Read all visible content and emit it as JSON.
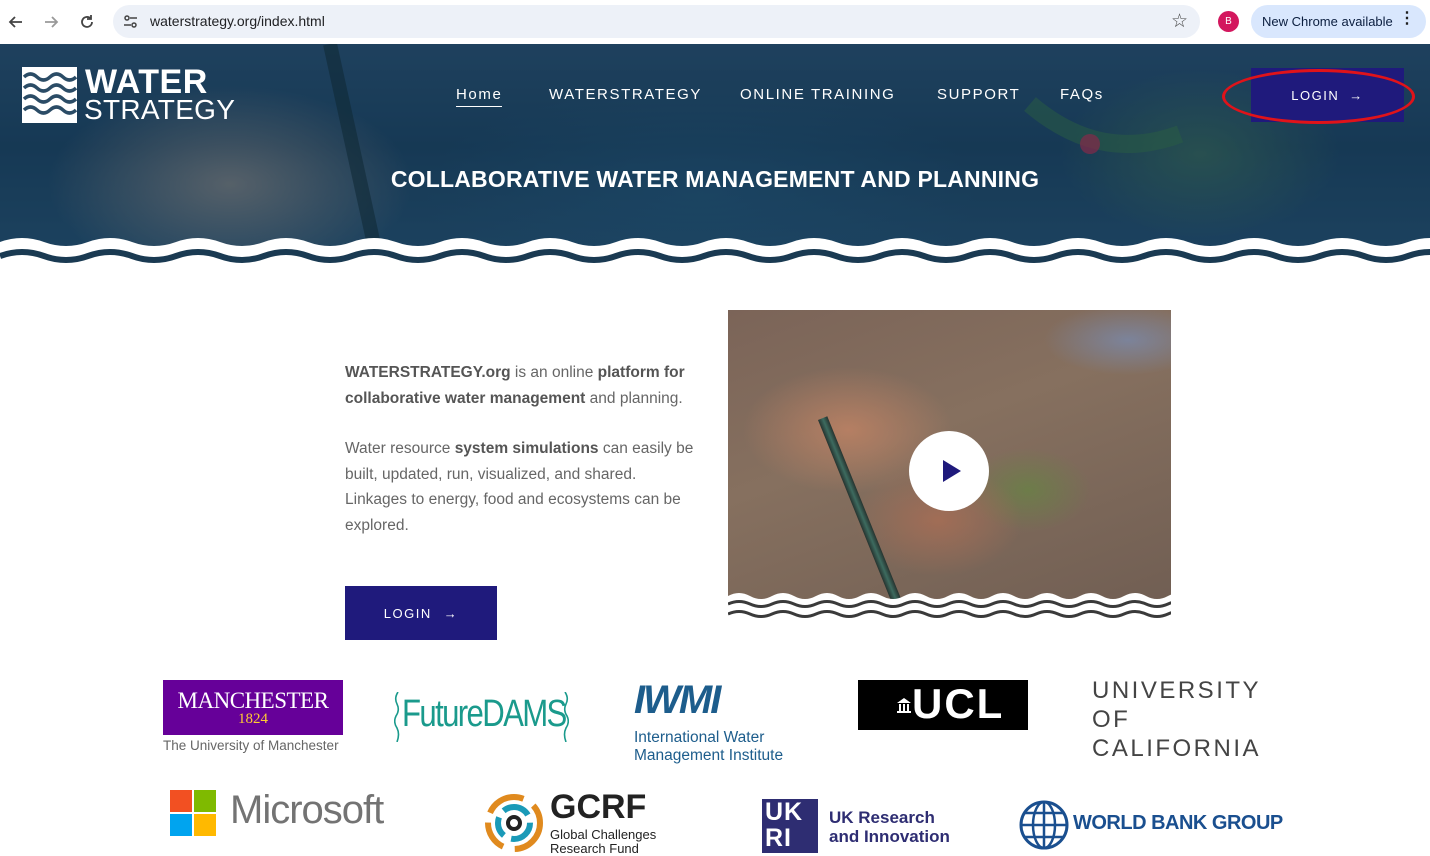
{
  "browser": {
    "url": "waterstrategy.org/index.html",
    "profile_initial": "B",
    "update_label": "New Chrome available"
  },
  "site": {
    "logo": {
      "line1": "WATER",
      "line2": "STRATEGY"
    },
    "nav": [
      {
        "label": "Home",
        "active": true
      },
      {
        "label": "WATERSTRATEGY"
      },
      {
        "label": "ONLINE TRAINING"
      },
      {
        "label": "SUPPORT"
      },
      {
        "label": "FAQs"
      }
    ],
    "header_login": "LOGIN",
    "hero_title": "COLLABORATIVE WATER MANAGEMENT AND PLANNING",
    "intro": {
      "p1": {
        "a": "WATERSTRATEGY.org",
        "b": " is an online ",
        "c": "platform for collaborative water management",
        "d": " and planning."
      },
      "p2": {
        "a": "Water resource ",
        "b": "system simulations",
        "c": " can easily be built, updated, run, visualized, and shared. Linkages to energy, food and ecosystems can be explored."
      }
    },
    "body_login": "LOGIN",
    "arrow": "→"
  },
  "partners": {
    "manchester": {
      "name": "MANCHESTER",
      "year": "1824",
      "sub": "The University of Manchester"
    },
    "futuredams": {
      "name": "FutureDAMS"
    },
    "iwmi": {
      "mark": "IWMI",
      "line1": "International Water",
      "line2": "Management Institute"
    },
    "ucl": {
      "name": "UCL"
    },
    "uc": {
      "line1": "UNIVERSITY",
      "line2": "OF",
      "line3": "CALIFORNIA"
    },
    "microsoft": {
      "name": "Microsoft"
    },
    "gcrf": {
      "name": "GCRF",
      "line1": "Global Challenges",
      "line2": "Research Fund"
    },
    "ukri": {
      "mark": "UKRI",
      "line1": "UK Research",
      "line2": "and Innovation"
    },
    "worldbank": {
      "name": "WORLD BANK GROUP"
    }
  },
  "colors": {
    "primary": "#1f1a7c",
    "highlight": "#e0131a",
    "manchester_purple": "#660099",
    "manchester_gold": "#ffcc33",
    "futuredams_teal": "#1a9a8c",
    "iwmi_blue": "#1d5d8c",
    "worldbank_blue": "#1a4f8f"
  }
}
